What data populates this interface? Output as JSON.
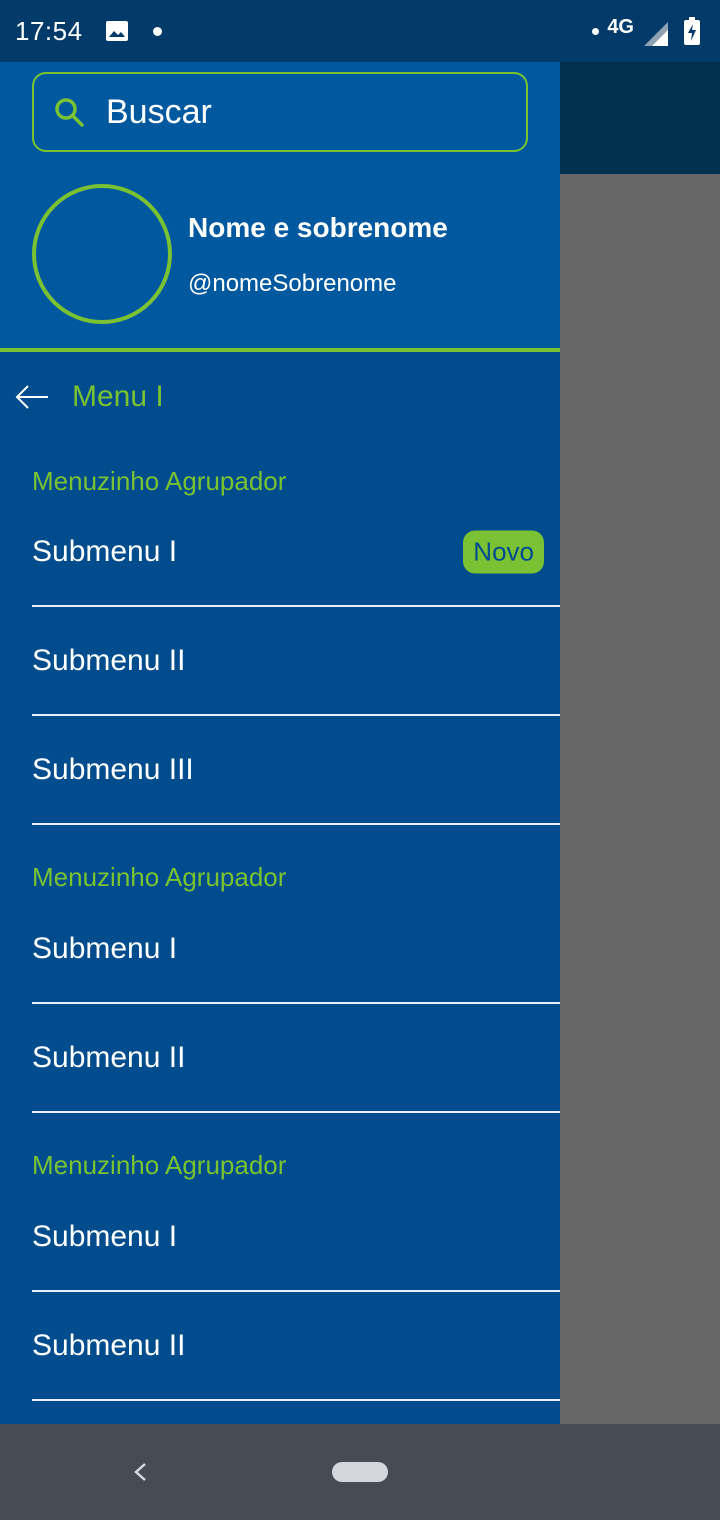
{
  "status_bar": {
    "time": "17:54",
    "network": "4G",
    "icons": [
      "image-notification-icon",
      "dot-icon",
      "signal-icon",
      "battery-charging-icon"
    ]
  },
  "drawer": {
    "search": {
      "placeholder": "Buscar",
      "icon": "search-icon"
    },
    "profile": {
      "name": "Nome e sobrenome",
      "handle": "@nomeSobrenome"
    },
    "menu": {
      "title": "Menu I",
      "back_icon": "arrow-left-icon"
    },
    "groups": [
      {
        "label": "Menuzinho Agrupador",
        "items": [
          {
            "label": "Submenu I",
            "badge": "Novo"
          },
          {
            "label": "Submenu II"
          },
          {
            "label": "Submenu III"
          }
        ]
      },
      {
        "label": "Menuzinho Agrupador",
        "items": [
          {
            "label": "Submenu I"
          },
          {
            "label": "Submenu II"
          }
        ]
      },
      {
        "label": "Menuzinho Agrupador",
        "items": [
          {
            "label": "Submenu I"
          },
          {
            "label": "Submenu II"
          }
        ]
      }
    ]
  },
  "colors": {
    "drawer_bg": "#004c8c",
    "header_bg": "#00599e",
    "accent": "#7ac134",
    "status_bar": "#023b6a",
    "nav_bar": "#454c54",
    "scrim": "#666666"
  }
}
